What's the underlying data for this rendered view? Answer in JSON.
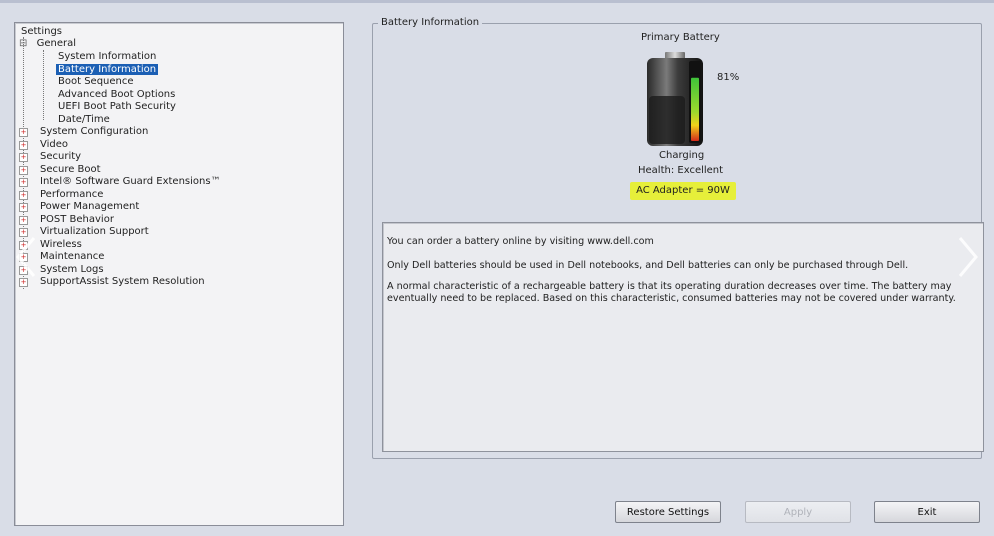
{
  "tree": {
    "root": "Settings",
    "general": {
      "label": "General",
      "children": [
        "System Information",
        "Battery Information",
        "Boot Sequence",
        "Advanced Boot Options",
        "UEFI Boot Path Security",
        "Date/Time"
      ],
      "selected": "Battery Information"
    },
    "sections": [
      "System Configuration",
      "Video",
      "Security",
      "Secure Boot",
      "Intel® Software Guard Extensions™",
      "Performance",
      "Power Management",
      "POST Behavior",
      "Virtualization Support",
      "Wireless",
      "Maintenance",
      "System Logs",
      "SupportAssist System Resolution"
    ]
  },
  "battery": {
    "group_title": "Battery Information",
    "primary_label": "Primary Battery",
    "percent_label": "81%",
    "charge_level": 0.81,
    "status": "Charging",
    "health": "Health: Excellent",
    "ac_adapter": "AC Adapter = 90W",
    "highlight_color": "#e6ef3a"
  },
  "info": {
    "line1": "You can order a battery online by visiting www.dell.com",
    "line2": "Only Dell batteries should be used in Dell notebooks, and Dell batteries can only be purchased through Dell.",
    "line3": "A normal characteristic of a rechargeable battery is that its operating duration decreases over time.  The battery may eventually need to be replaced.  Based on this characteristic, consumed batteries may not be covered under warranty."
  },
  "buttons": {
    "restore": "Restore Settings",
    "apply": "Apply",
    "exit": "Exit"
  },
  "icons": {
    "prev": "chevron-left-icon",
    "next": "chevron-right-icon",
    "battery": "battery-icon"
  }
}
